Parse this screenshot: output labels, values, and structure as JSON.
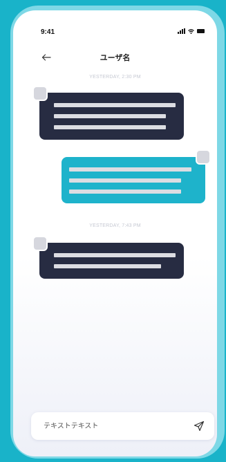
{
  "status_bar": {
    "time": "9:41"
  },
  "header": {
    "title": "ユーザ名",
    "back_icon": "arrow-left-icon"
  },
  "messages": {
    "timestamp_1": "YESTERDAY, 2:30 PM",
    "timestamp_2": "YESTERDAY, 7:43 PM"
  },
  "composer": {
    "placeholder": "テキストテキスト",
    "send_icon": "send-icon"
  },
  "colors": {
    "background": "#19b3c9",
    "frame": "#7ed8e6",
    "incoming_bubble": "#272c42",
    "outgoing_bubble": "#1eb3cb",
    "placeholder_line": "#dcdde2"
  }
}
